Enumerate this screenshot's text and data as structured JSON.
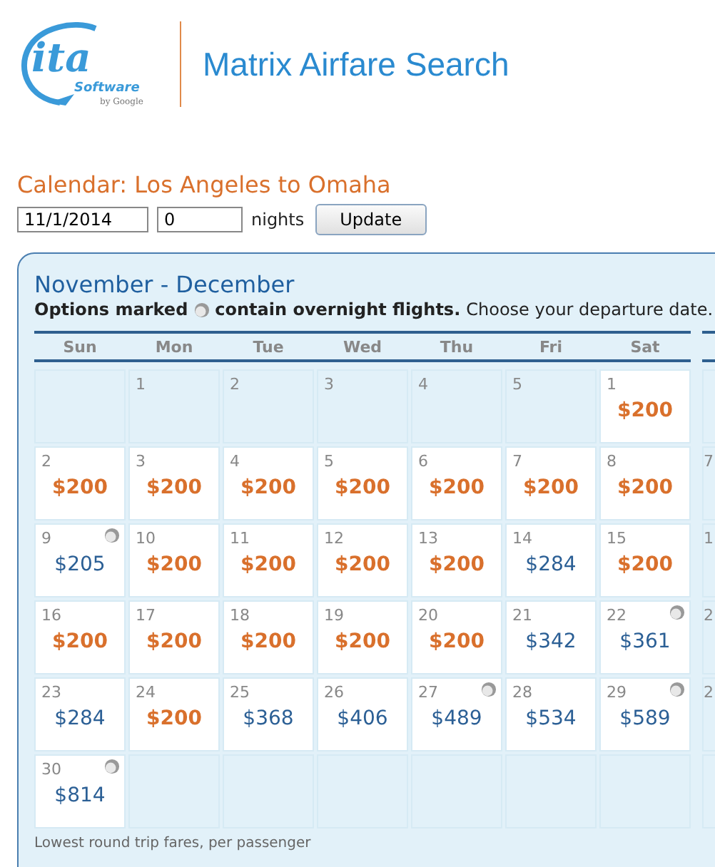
{
  "header": {
    "logo": {
      "wordmark": "ita",
      "subtitle": "Software",
      "byline": "by Google"
    },
    "title": "Matrix Airfare Search"
  },
  "calendar": {
    "heading": "Calendar: Los Angeles to Omaha",
    "date_value": "11/1/2014",
    "nights_value": "0",
    "nights_label": "nights",
    "button": "Update"
  },
  "panel": {
    "title": "November - December",
    "note_bold_before": "Options marked",
    "note_bold_after": "contain overnight flights.",
    "note_rest": "Choose your departure date.",
    "weekdays": [
      "Sun",
      "Mon",
      "Tue",
      "Wed",
      "Thu",
      "Fri",
      "Sat"
    ],
    "weeks": [
      [
        {
          "kind": "blank"
        },
        {
          "kind": "day",
          "day": "1"
        },
        {
          "kind": "day",
          "day": "2"
        },
        {
          "kind": "day",
          "day": "3"
        },
        {
          "kind": "day",
          "day": "4"
        },
        {
          "kind": "day",
          "day": "5"
        },
        {
          "kind": "fare",
          "day": "1",
          "price": "$200",
          "lowest": true,
          "overnight": false
        }
      ],
      [
        {
          "kind": "fare",
          "day": "2",
          "price": "$200",
          "lowest": true,
          "overnight": false
        },
        {
          "kind": "fare",
          "day": "3",
          "price": "$200",
          "lowest": true,
          "overnight": false
        },
        {
          "kind": "fare",
          "day": "4",
          "price": "$200",
          "lowest": true,
          "overnight": false
        },
        {
          "kind": "fare",
          "day": "5",
          "price": "$200",
          "lowest": true,
          "overnight": false
        },
        {
          "kind": "fare",
          "day": "6",
          "price": "$200",
          "lowest": true,
          "overnight": false
        },
        {
          "kind": "fare",
          "day": "7",
          "price": "$200",
          "lowest": true,
          "overnight": false
        },
        {
          "kind": "fare",
          "day": "8",
          "price": "$200",
          "lowest": true,
          "overnight": false
        }
      ],
      [
        {
          "kind": "fare",
          "day": "9",
          "price": "$205",
          "lowest": false,
          "overnight": true
        },
        {
          "kind": "fare",
          "day": "10",
          "price": "$200",
          "lowest": true,
          "overnight": false
        },
        {
          "kind": "fare",
          "day": "11",
          "price": "$200",
          "lowest": true,
          "overnight": false
        },
        {
          "kind": "fare",
          "day": "12",
          "price": "$200",
          "lowest": true,
          "overnight": false
        },
        {
          "kind": "fare",
          "day": "13",
          "price": "$200",
          "lowest": true,
          "overnight": false
        },
        {
          "kind": "fare",
          "day": "14",
          "price": "$284",
          "lowest": false,
          "overnight": false
        },
        {
          "kind": "fare",
          "day": "15",
          "price": "$200",
          "lowest": true,
          "overnight": false
        }
      ],
      [
        {
          "kind": "fare",
          "day": "16",
          "price": "$200",
          "lowest": true,
          "overnight": false
        },
        {
          "kind": "fare",
          "day": "17",
          "price": "$200",
          "lowest": true,
          "overnight": false
        },
        {
          "kind": "fare",
          "day": "18",
          "price": "$200",
          "lowest": true,
          "overnight": false
        },
        {
          "kind": "fare",
          "day": "19",
          "price": "$200",
          "lowest": true,
          "overnight": false
        },
        {
          "kind": "fare",
          "day": "20",
          "price": "$200",
          "lowest": true,
          "overnight": false
        },
        {
          "kind": "fare",
          "day": "21",
          "price": "$342",
          "lowest": false,
          "overnight": false
        },
        {
          "kind": "fare",
          "day": "22",
          "price": "$361",
          "lowest": false,
          "overnight": true
        }
      ],
      [
        {
          "kind": "fare",
          "day": "23",
          "price": "$284",
          "lowest": false,
          "overnight": false
        },
        {
          "kind": "fare",
          "day": "24",
          "price": "$200",
          "lowest": true,
          "overnight": false
        },
        {
          "kind": "fare",
          "day": "25",
          "price": "$368",
          "lowest": false,
          "overnight": false
        },
        {
          "kind": "fare",
          "day": "26",
          "price": "$406",
          "lowest": false,
          "overnight": false
        },
        {
          "kind": "fare",
          "day": "27",
          "price": "$489",
          "lowest": false,
          "overnight": true
        },
        {
          "kind": "fare",
          "day": "28",
          "price": "$534",
          "lowest": false,
          "overnight": false
        },
        {
          "kind": "fare",
          "day": "29",
          "price": "$589",
          "lowest": false,
          "overnight": true
        }
      ],
      [
        {
          "kind": "fare",
          "day": "30",
          "price": "$814",
          "lowest": false,
          "overnight": true
        },
        {
          "kind": "blank"
        },
        {
          "kind": "blank"
        },
        {
          "kind": "blank"
        },
        {
          "kind": "blank"
        },
        {
          "kind": "blank"
        },
        {
          "kind": "blank"
        }
      ]
    ],
    "next_month_column": [
      {
        "kind": "blank"
      },
      {
        "kind": "day",
        "day": "7"
      },
      {
        "kind": "day",
        "day": "1"
      },
      {
        "kind": "day",
        "day": "2"
      },
      {
        "kind": "day",
        "day": "2"
      },
      {
        "kind": "blank"
      }
    ],
    "footnote": "Lowest round trip fares, per passenger"
  }
}
